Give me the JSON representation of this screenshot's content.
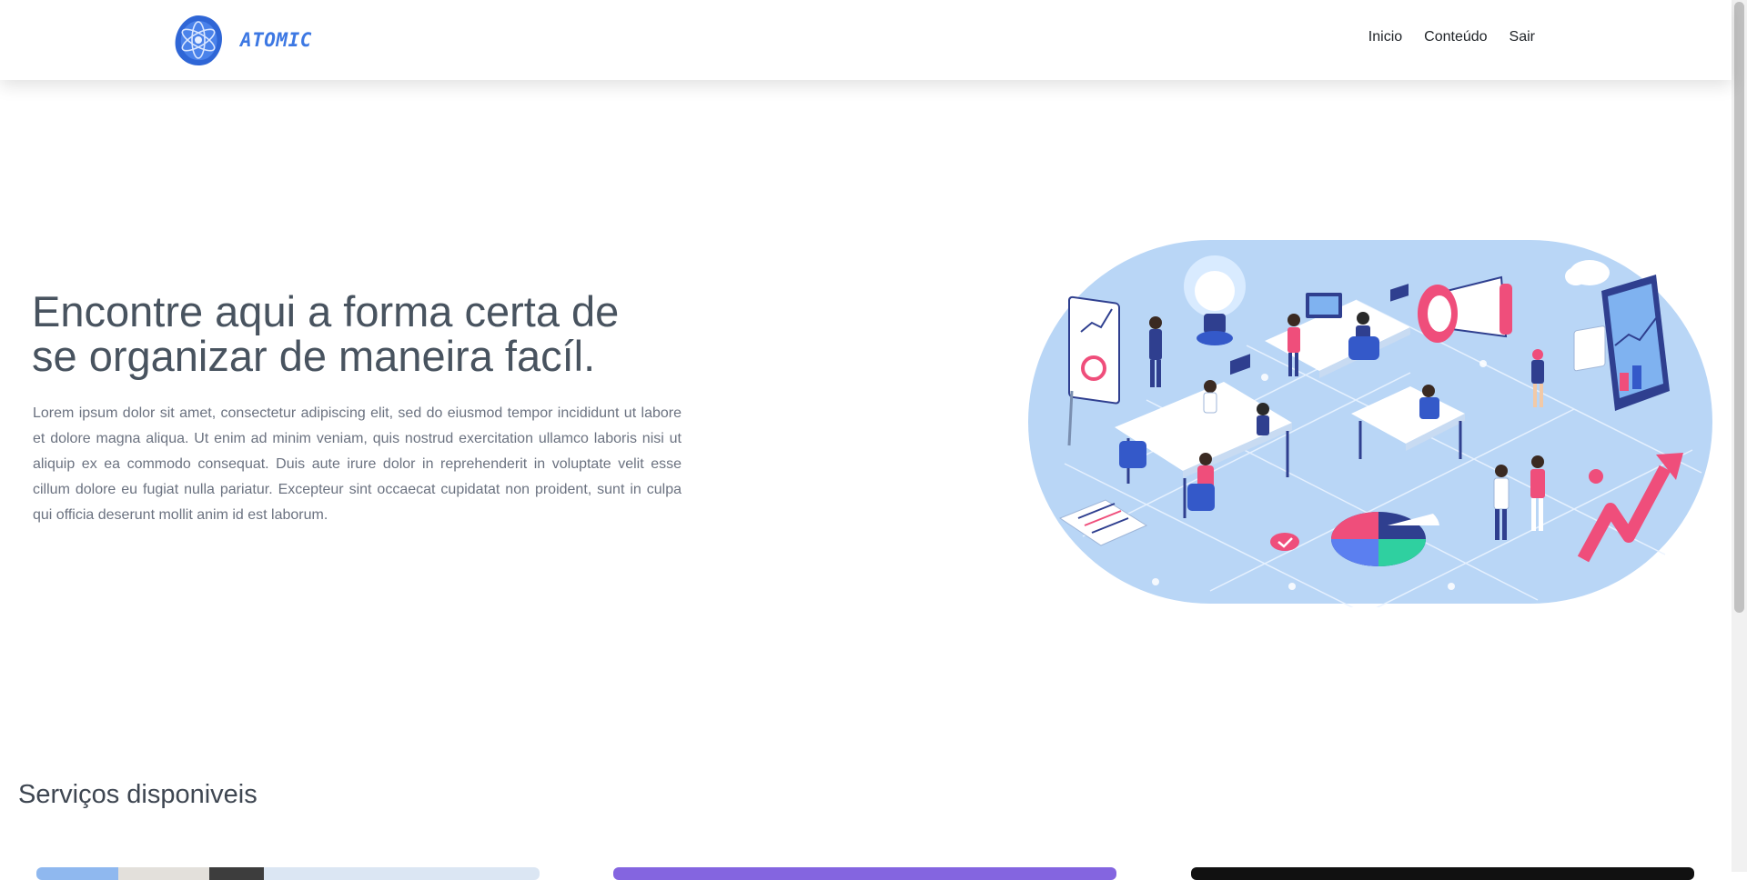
{
  "navbar": {
    "brand": "ATOMIC",
    "links": [
      "Inicio",
      "Conteúdo",
      "Sair"
    ]
  },
  "hero": {
    "title_line1": "Encontre aqui a forma certa de",
    "title_line2": "se organizar de maneira facíl.",
    "paragraph": "Lorem ipsum dolor sit amet, consectetur adipiscing elit, sed do eiusmod tempor incididunt ut labore et dolore magna aliqua. Ut enim ad minim veniam, quis nostrud exercitation ullamco laboris nisi ut aliquip ex ea commodo consequat. Duis aute irure dolor in reprehenderit in voluptate velit esse cillum dolore eu fugiat nulla pariatur. Excepteur sint occaecat cupidatat non proident, sunt in culpa qui officia deserunt mollit anim id est laborum."
  },
  "services": {
    "title": "Serviços disponiveis"
  },
  "icons": {
    "logo": "atom-logo-icon",
    "illustration": "isometric-office-illustration"
  },
  "colors": {
    "brand": "#3d78e3",
    "accent_pink": "#ef4e7b",
    "illustration_bg": "#b9d6f6"
  }
}
